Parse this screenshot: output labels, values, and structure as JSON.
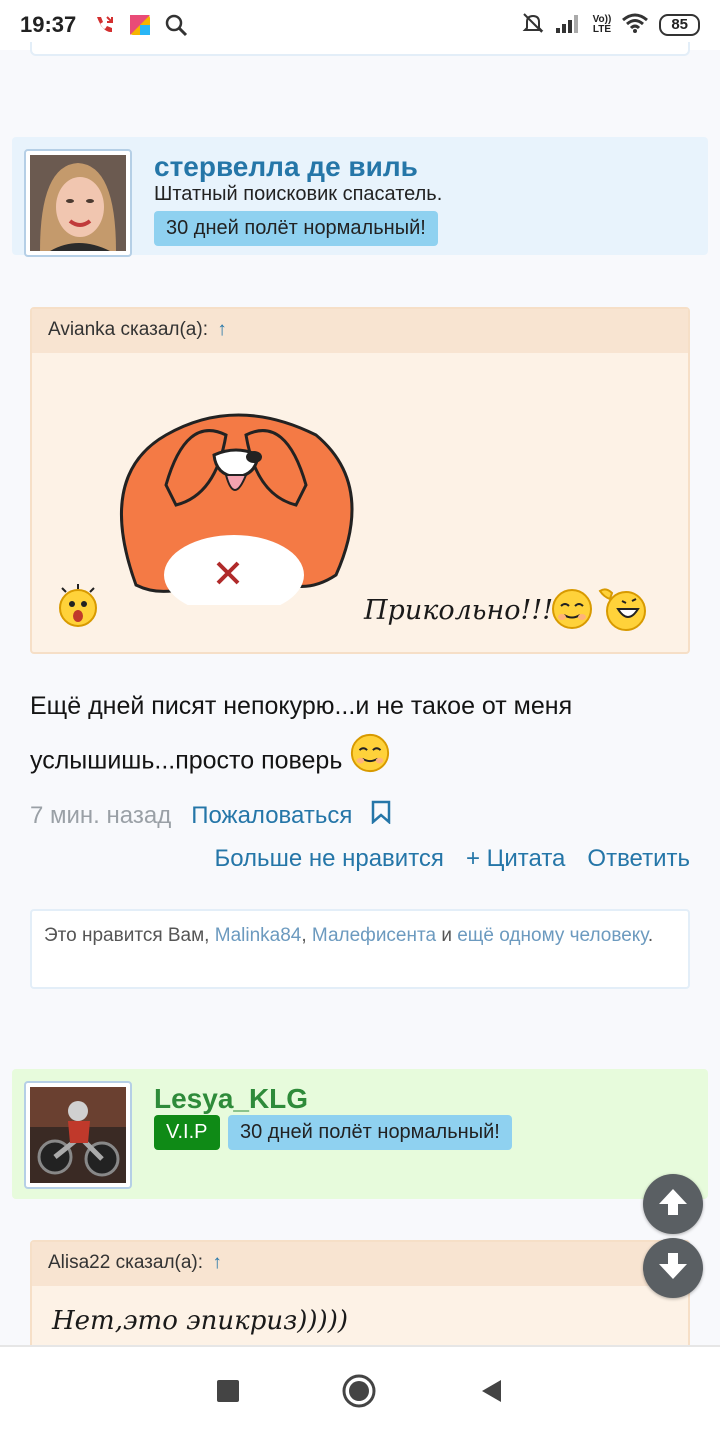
{
  "status_bar": {
    "time": "19:37",
    "battery": "85",
    "network_label_top": "Vo))",
    "network_label_bottom": "LTE"
  },
  "posts": [
    {
      "user": {
        "name": "стервелла де виль",
        "title": "Штатный поисковик спасатель.",
        "badge": "30 дней полёт нормальный!"
      },
      "quote": {
        "author_line": "Avianka сказал(а):",
        "arrow": "↑",
        "text": "Прикольно!!!"
      },
      "message": "Ещё дней писят непокурю...и не такое от меня услышишь...просто поверь",
      "meta": {
        "time": "7 мин. назад",
        "report": "Пожаловаться"
      },
      "actions": {
        "unlike": "Больше не нравится",
        "quote": "+ Цитата",
        "reply": "Ответить"
      },
      "likes": {
        "prefix": "Это нравится Вам,",
        "user1": "Malinka84",
        "sep1": ",",
        "user2": "Малефисента",
        "and": "и",
        "more": "ещё одному человеку",
        "end": "."
      }
    },
    {
      "user": {
        "name": "Lesya_KLG",
        "vip": "V.I.P",
        "badge": "30 дней полёт нормальный!"
      },
      "quote": {
        "author_line": "Alisa22 сказал(а):",
        "arrow": "↑",
        "text": "Нет,это эпикриз)))))"
      }
    }
  ]
}
